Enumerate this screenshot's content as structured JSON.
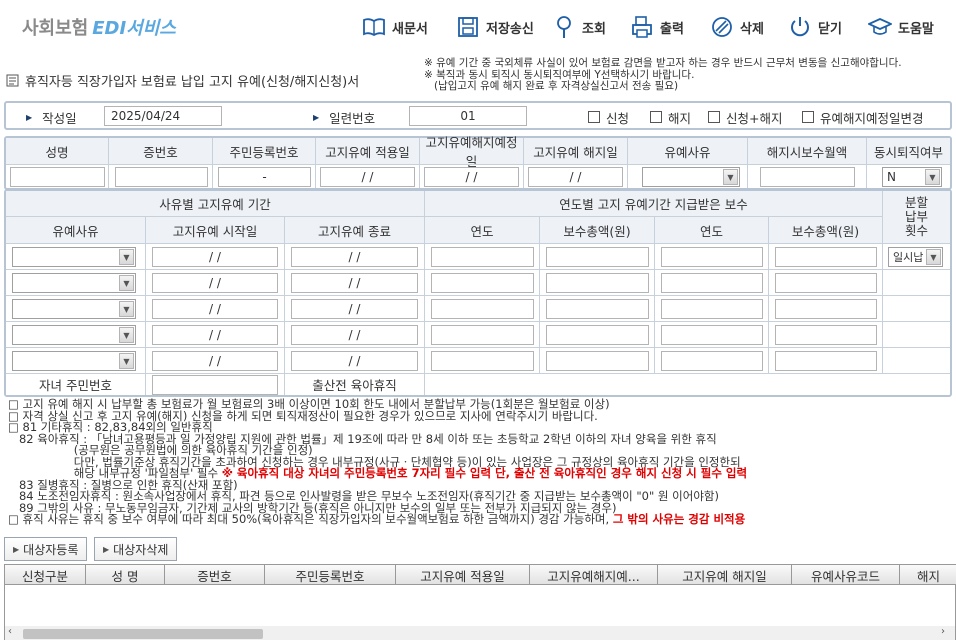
{
  "header": {
    "logo_text": "사회보험",
    "logo_accent": "EDI서비스",
    "toolbar": [
      {
        "label": "새문서",
        "icon": "book-open-icon"
      },
      {
        "label": "저장송신",
        "icon": "save-icon"
      },
      {
        "label": "조회",
        "icon": "search-pin-icon"
      },
      {
        "label": "출력",
        "icon": "printer-icon"
      },
      {
        "label": "삭제",
        "icon": "delete-icon"
      },
      {
        "label": "닫기",
        "icon": "power-icon"
      },
      {
        "label": "도움말",
        "icon": "graduation-cap-icon"
      }
    ]
  },
  "page_title": "휴직자등 직장가입자 보험료 납입 고지 유예(신청/해지신청)서",
  "notes": "※ 유예 기간 중 국외체류 사실이 있어 보험료 감면을 받고자 하는 경우 반드시 근무처 변동을 신고해야합니다.\n※ 복직과 동시 퇴직시 동시퇴직여부에 Y선택하시기 바랍니다.\n   (납입고지 유예 해지 완료 후 자격상실신고서 전송 필요)",
  "form_header": {
    "date_label": "작성일",
    "date_value": "2025/04/24",
    "serial_label": "일련번호",
    "serial_value": "01",
    "checks": [
      "신청",
      "해지",
      "신청+해지",
      "유예해지예정일변경"
    ]
  },
  "person_table": {
    "headers": [
      "성명",
      "증번호",
      "주민등록번호",
      "고지유예 적용일",
      "고지유예해지예정일",
      "고지유예 해지일",
      "유예사유",
      "해지시보수월액",
      "동시퇴직여부"
    ],
    "rrn_placeholder": "-",
    "date_placeholder": "/ /",
    "retire_value": "N"
  },
  "period_table": {
    "section_left": "사유별 고지유예 기간",
    "section_right": "연도별 고지 유예기간 지급받은 보수",
    "installment_header": "분할\n납부\n횟수",
    "installment_value": "일시납",
    "headers_left": [
      "유예사유",
      "고지유예 시작일",
      "고지유예 종료"
    ],
    "headers_right": [
      "연도",
      "보수총액(원)",
      "연도",
      "보수총액(원)"
    ],
    "date_placeholder": "/ /",
    "child_rrn_label": "자녀 주민번호",
    "prenatal_label": "출산전 육아휴직"
  },
  "info_lines": [
    {
      "t": "□ 고지 유예 해지 시 납부할 총 보험료가 월 보험료의 3배 이상이면 10회 한도 내에서 분할납부 가능(1회분은 월보험료 이상)"
    },
    {
      "t": "□ 자격 상실 신고 후 고지 유예(해지) 신청을 하게 되면 퇴직재정산이 필요한 경우가 있으므로 지사에 연락주시기 바랍니다."
    },
    {
      "t": "□ 81 기타휴직 : 82,83,84외의 일반휴직"
    },
    {
      "t": "   82 육아휴직 : 「남녀고용평등과 일 가정양립 지원에 관한 법률」제 19조에 따라 만 8세 이하 또는 초등학교 2학년 이하의 자녀 양육을 위한 휴직"
    },
    {
      "t": "                  (공무원은 공무원법에 의한 육아휴직 기간을 인정)"
    },
    {
      "t": "                  다만, 법률기준상 휴직기간을 초과하여 신청하는 경우 내부규정(사규ㆍ단체협약 등)이 있는 사업장은 그 규정상의 육아휴직 기간을 인정한되"
    },
    {
      "t": "                  해당 내부규정 '파일첨부' 필수 ",
      "red": "※ 육아휴직 대상 자녀의 주민등록번호 7자리 필수 입력 단, 출산 전 육아휴직인 경우 해지 신청 시 필수 입력"
    },
    {
      "t": "   83 질병휴직 : 질병으로 인한 휴직(산재 포함)"
    },
    {
      "t": "   84 노조전임자휴직 : 원소속사업장에서 휴직, 파견 등으로 인사발령을 받은 무보수 노조전임자(휴직기간 중 지급받는 보수총액이 \"0\" 원 이어야함)"
    },
    {
      "t": "   89 그밖의 사유 : 무노동무임금자, 기간제 교사의 방학기간 등(휴직은 아니지만 보수의 일부 또는 전부가 지급되지 않는 경우)"
    },
    {
      "t": "□ 휴직 사유는 휴직 중 보수 여부에 따라 최대 50%(육아휴직은 직장가입자의 보수월액보험료 하한 금액까지) 경감 가능하며, ",
      "red": "그 밖의 사유는 경감 비적용"
    }
  ],
  "buttons": {
    "register": "대상자등록",
    "remove": "대상자삭제"
  },
  "grid": {
    "columns": [
      "신청구분",
      "성 명",
      "증번호",
      "주민등록번호",
      "고지유예 적용일",
      "고지유예해지예...",
      "고지유예 해지일",
      "유예사유코드",
      "해지"
    ]
  }
}
